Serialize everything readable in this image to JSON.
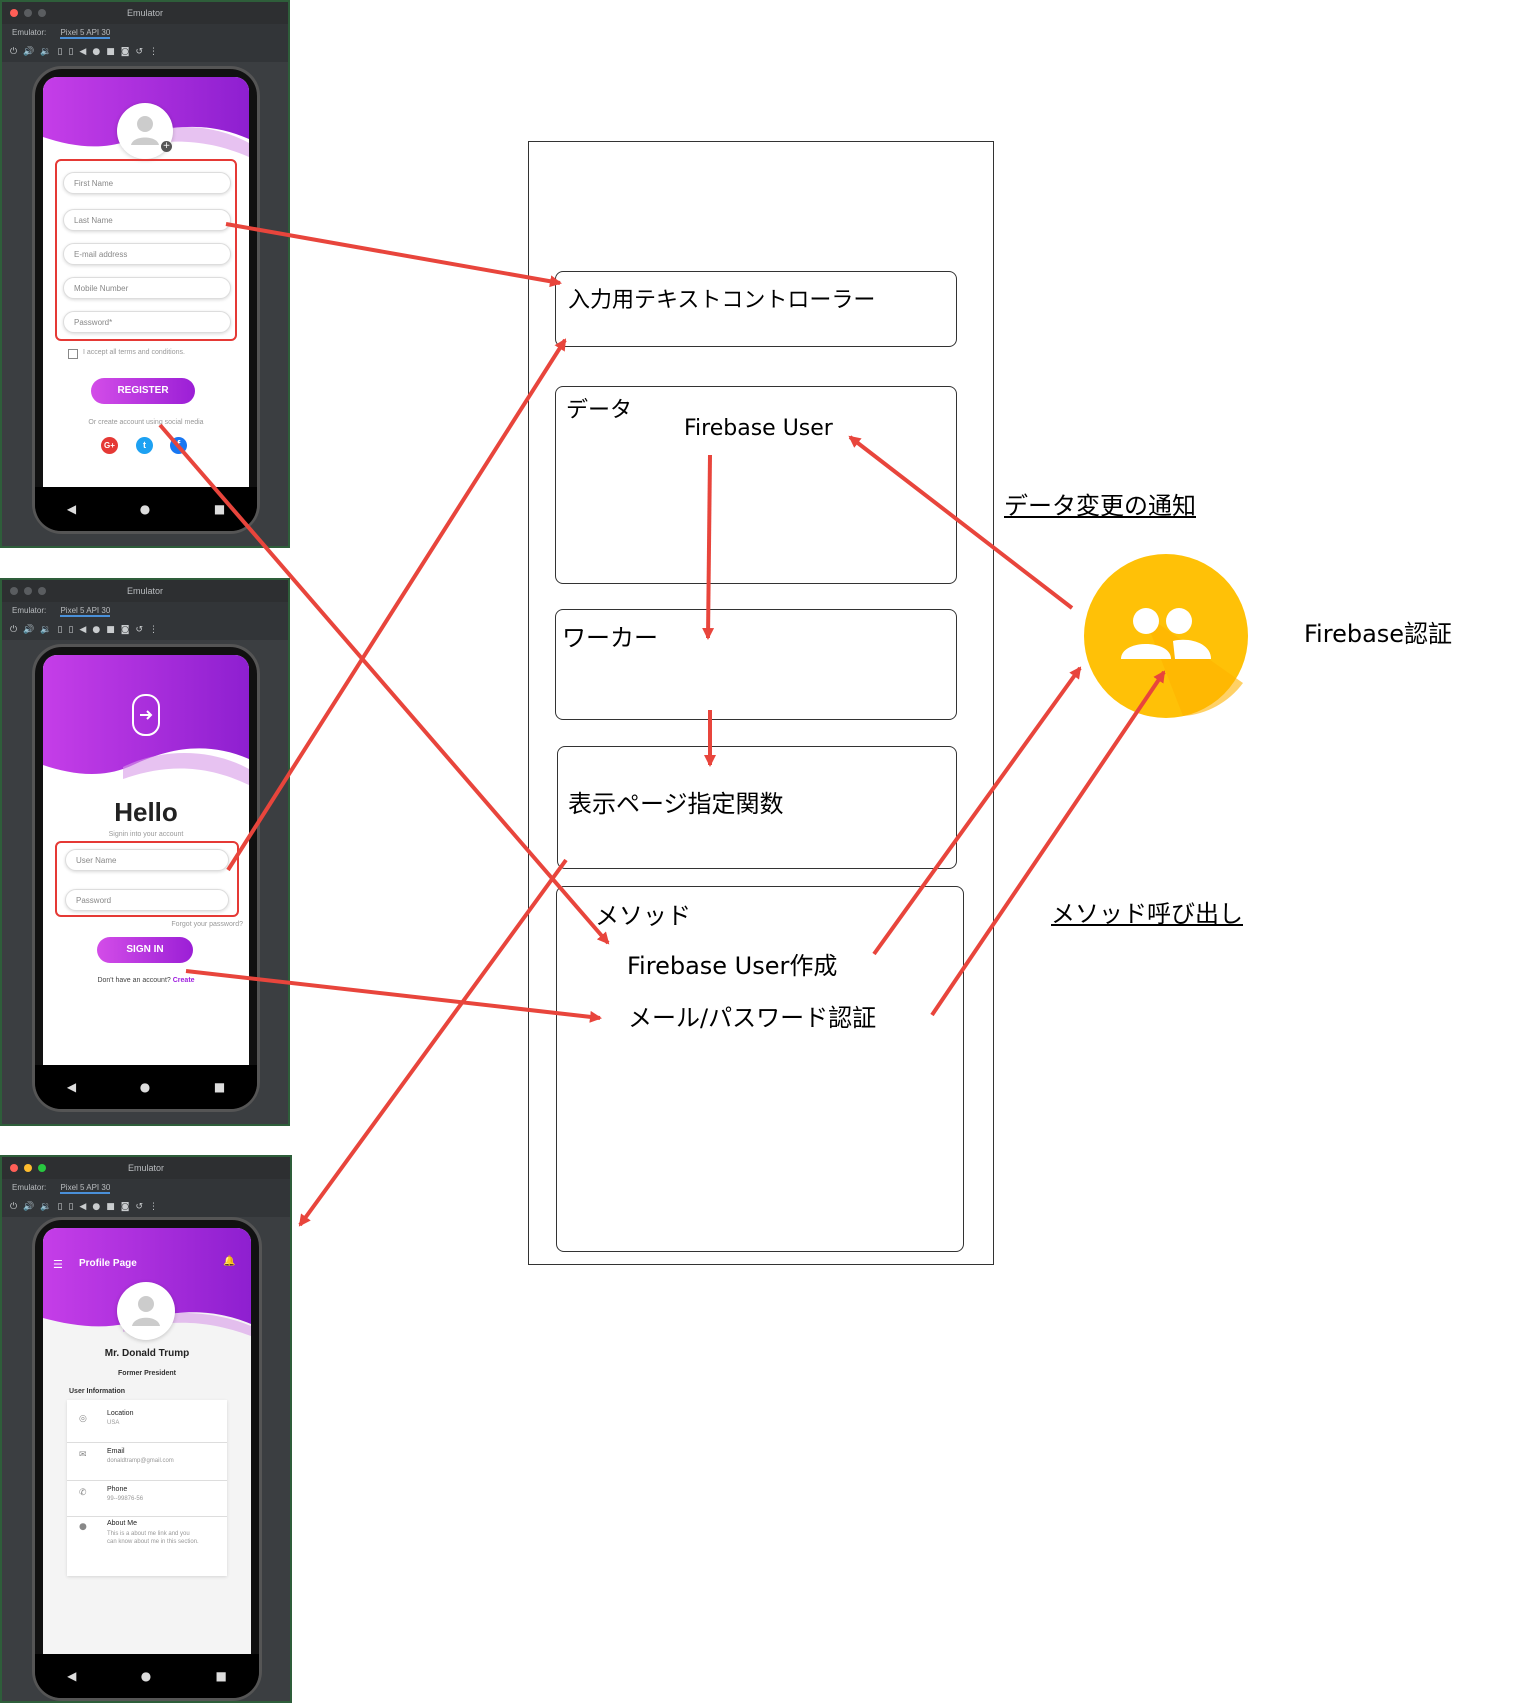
{
  "emulator": {
    "title": "Emulator",
    "tab_prefix": "Emulator:",
    "device_tab": "Pixel 5 API 30",
    "toolbar_icons": [
      "power-icon",
      "volume-up-icon",
      "volume-down-icon",
      "rotate-left-icon",
      "rotate-right-icon",
      "back-icon",
      "home-icon",
      "stop-icon",
      "camera-icon",
      "replay-icon",
      "more-icon"
    ],
    "nav": {
      "back": "◀",
      "home": "●",
      "recents": "■"
    }
  },
  "register_screen": {
    "fields": [
      "First Name",
      "Last Name",
      "E-mail address",
      "Mobile Number",
      "Password*"
    ],
    "terms": "I accept all terms and conditions.",
    "button": "REGISTER",
    "social_text": "Or create account using social media",
    "social_icons": [
      "google-plus-icon",
      "twitter-icon",
      "facebook-icon"
    ],
    "colors": {
      "google": "#e53935",
      "twitter": "#1da1f2",
      "facebook": "#1877f2"
    }
  },
  "login_screen": {
    "heading": "Hello",
    "subheading": "Signin into your account",
    "fields": [
      "User Name",
      "Password"
    ],
    "forgot": "Forgot your password?",
    "button": "SIGN IN",
    "no_account": "Don't have an account?",
    "create": "Create"
  },
  "profile_screen": {
    "title": "Profile Page",
    "name": "Mr. Donald Trump",
    "role": "Former President",
    "section": "User Information",
    "items": [
      {
        "label": "Location",
        "value": "USA",
        "icon": "location-icon"
      },
      {
        "label": "Email",
        "value": "donaldtramp@gmail.com",
        "icon": "email-icon"
      },
      {
        "label": "Phone",
        "value": "99--99876-56",
        "icon": "phone-icon"
      },
      {
        "label": "About Me",
        "value": "This is a about me link and you can know about me in this section.",
        "icon": "person-icon"
      }
    ]
  },
  "diagram": {
    "controllers": "入力用テキストコントローラー",
    "data_title": "データ",
    "data_item": "Firebase User",
    "worker": "ワーカー",
    "page_fn": "表示ページ指定関数",
    "method_title": "メソッド",
    "method_create": "Firebase User作成",
    "method_auth": "メール/パスワード認証",
    "notify": "データ変更の通知",
    "call": "メソッド呼び出し",
    "firebase_auth": "Firebase認証"
  },
  "colors": {
    "accent": "#a020e0",
    "arrow": "#e8453c",
    "firebase": "#ffc107"
  }
}
